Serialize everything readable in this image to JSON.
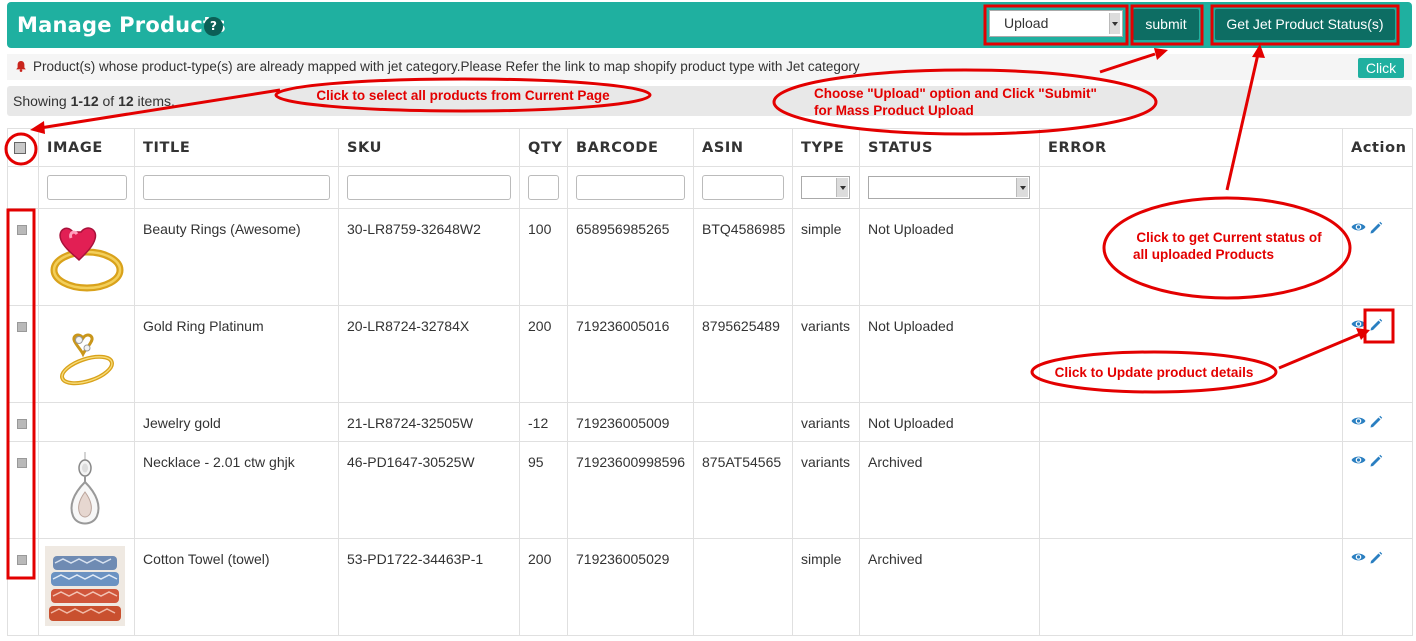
{
  "header": {
    "title": "Manage Products",
    "help_icon": "?",
    "bulk_action": "Upload",
    "submit_label": "submit",
    "status_label": "Get Jet Product Status(s)"
  },
  "notice": {
    "text": "Product(s) whose product-type(s) are already mapped with jet category.Please Refer the link to map shopify product type with Jet category",
    "click_label": "Click"
  },
  "summary": {
    "prefix": "Showing ",
    "range": "1-12",
    "mid": " of ",
    "total": "12",
    "suffix": " items."
  },
  "table": {
    "columns": [
      "IMAGE",
      "TITLE",
      "SKU",
      "QTY",
      "BARCODE",
      "ASIN",
      "TYPE",
      "STATUS",
      "ERROR",
      "Action"
    ],
    "rows": [
      {
        "image": "heart-ring",
        "title": "Beauty Rings (Awesome)",
        "sku": "30-LR8759-32648W2",
        "qty": "100",
        "barcode": "658956985265",
        "asin": "BTQ4586985",
        "type": "simple",
        "status": "Not Uploaded",
        "error": ""
      },
      {
        "image": "gold-ring",
        "title": "Gold Ring Platinum",
        "sku": "20-LR8724-32784X",
        "qty": "200",
        "barcode": "719236005016",
        "asin": "8795625489",
        "type": "variants",
        "status": "Not Uploaded",
        "error": ""
      },
      {
        "image": "",
        "title": "Jewelry gold",
        "sku": "21-LR8724-32505W",
        "qty": "-12",
        "barcode": "719236005009",
        "asin": "",
        "type": "variants",
        "status": "Not Uploaded",
        "error": ""
      },
      {
        "image": "pendant-necklace",
        "title": "Necklace - 2.01 ctw ghjk",
        "sku": "46-PD1647-30525W",
        "qty": "95",
        "barcode": "71923600998596",
        "asin": "875AT54565",
        "type": "variants",
        "status": "Archived",
        "error": ""
      },
      {
        "image": "towels",
        "title": "Cotton Towel (towel)",
        "sku": "53-PD1722-34463P-1",
        "qty": "200",
        "barcode": "719236005029",
        "asin": "",
        "type": "simple",
        "status": "Archived",
        "error": ""
      }
    ]
  },
  "annotations": {
    "select_all": "Click to select all products from Current Page",
    "upload_line1": "Choose \"Upload\" option and Click \"Submit\"",
    "upload_line2": "for Mass Product Upload",
    "status_line1": "Click to get Current status of",
    "status_line2": "all uploaded Products",
    "update": "Click to Update product details"
  },
  "colors": {
    "header_bg": "#1fb0a0",
    "button_bg": "#0d6d63",
    "annotation": "#e30000",
    "action_icon": "#2a7fc1"
  },
  "icons": {
    "bell": "bell-icon",
    "view": "eye-icon",
    "edit": "pencil-icon"
  }
}
